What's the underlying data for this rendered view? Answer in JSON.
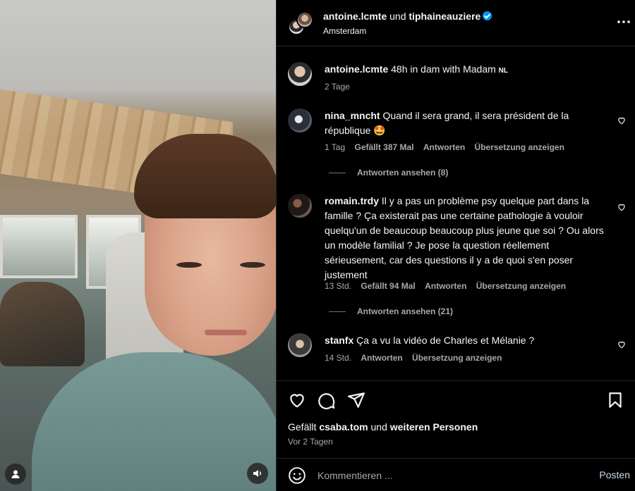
{
  "header": {
    "user1": "antoine.lcmte",
    "joiner": "und",
    "user2": "tiphaineauziere",
    "location": "Amsterdam",
    "more_icon": "more-horizontal-icon"
  },
  "caption": {
    "username": "antoine.lcmte",
    "text": "48h in dam with Madam",
    "flag": "NL",
    "time": "2 Tage"
  },
  "comments": [
    {
      "username": "nina_mncht",
      "text": "Quand il sera grand, il sera président de la république 🤩",
      "time": "1 Tag",
      "likes": "Gefällt 387 Mal",
      "reply": "Antworten",
      "translate": "Übersetzung anzeigen",
      "view_replies": "Antworten ansehen (8)"
    },
    {
      "username": "romain.trdy",
      "text": "Il y a pas un problème psy quelque part dans la famille ? Ça existerait pas une certaine pathologie à vouloir quelqu'un de beaucoup beaucoup plus jeune que soi ? Ou alors un modèle familial ? Je pose la question réellement sérieusement, car des questions il y a de quoi s'en poser justement",
      "time": "13 Std.",
      "likes": "Gefällt 94 Mal",
      "reply": "Antworten",
      "translate": "Übersetzung anzeigen",
      "view_replies": "Antworten ansehen (21)"
    },
    {
      "username": "stanfx",
      "text": "Ça a vu la vidéo de Charles et Mélanie ?",
      "time": "14 Std.",
      "reply": "Antworten",
      "translate": "Übersetzung anzeigen"
    }
  ],
  "likes_line": {
    "prefix": "Gefällt",
    "user": "csaba.tom",
    "middle": "und",
    "suffix": "weiteren Personen"
  },
  "post_age": "Vor 2 Tagen",
  "composer": {
    "placeholder": "Kommentieren ...",
    "post_label": "Posten"
  }
}
